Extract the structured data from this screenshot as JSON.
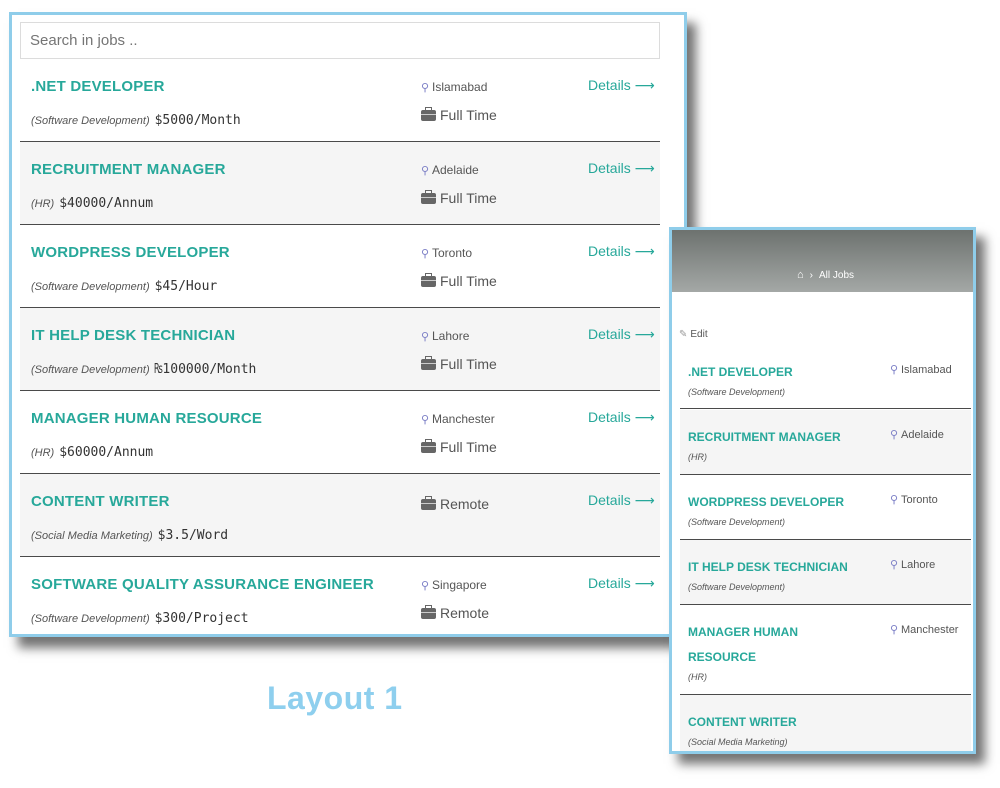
{
  "layout1": {
    "search_placeholder": "Search in jobs ..",
    "details_label": "Details ⟶",
    "jobs": [
      {
        "title": ".NET DEVELOPER",
        "category": "(Software Development)",
        "salary": "$5000/Month",
        "location": "Islamabad",
        "type": "Full Time"
      },
      {
        "title": "RECRUITMENT MANAGER",
        "category": "(HR)",
        "salary": "$40000/Annum",
        "location": "Adelaide",
        "type": "Full Time"
      },
      {
        "title": "WORDPRESS DEVELOPER",
        "category": "(Software Development)",
        "salary": "$45/Hour",
        "location": "Toronto",
        "type": "Full Time"
      },
      {
        "title": "IT HELP DESK TECHNICIAN",
        "category": "(Software Development)",
        "salary": "₨100000/Month",
        "location": "Lahore",
        "type": "Full Time"
      },
      {
        "title": "MANAGER HUMAN RESOURCE",
        "category": "(HR)",
        "salary": "$60000/Annum",
        "location": "Manchester",
        "type": "Full Time"
      },
      {
        "title": "CONTENT WRITER",
        "category": "(Social Media Marketing)",
        "salary": "$3.5/Word",
        "location": "",
        "type": "Remote"
      },
      {
        "title": "SOFTWARE QUALITY ASSURANCE ENGINEER",
        "category": "(Software Development)",
        "salary": "$300/Project",
        "location": "Singapore",
        "type": "Remote"
      }
    ]
  },
  "label": "Layout 1",
  "layout2": {
    "breadcrumb": "All Jobs",
    "edit_label": "Edit",
    "jobs": [
      {
        "title": ".NET DEVELOPER",
        "category": "(Software Development)",
        "location": "Islamabad"
      },
      {
        "title": "RECRUITMENT MANAGER",
        "category": "(HR)",
        "location": "Adelaide"
      },
      {
        "title": "WORDPRESS DEVELOPER",
        "category": "(Software Development)",
        "location": "Toronto"
      },
      {
        "title": "IT HELP DESK TECHNICIAN",
        "category": "(Software Development)",
        "location": "Lahore"
      },
      {
        "title": "MANAGER HUMAN RESOURCE",
        "category": "(HR)",
        "location": "Manchester"
      },
      {
        "title": "CONTENT WRITER",
        "category": "(Social Media Marketing)",
        "location": ""
      }
    ]
  },
  "colors": {
    "accent": "#27a89a",
    "frame_border": "#8fcdea",
    "pin": "#7c7fc6"
  },
  "icons": {
    "location": "map-pin-icon",
    "job_type": "briefcase-icon",
    "home": "home-icon",
    "edit": "edit-icon"
  }
}
